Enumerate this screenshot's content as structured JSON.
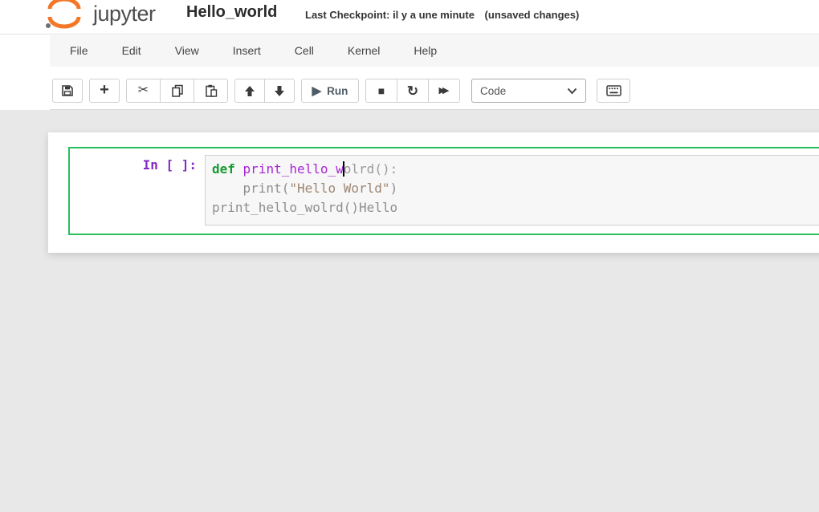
{
  "header": {
    "logo_text": "jupyter",
    "title": "Hello_world",
    "checkpoint": "Last Checkpoint: il y a une minute",
    "unsaved": "(unsaved changes)"
  },
  "menu": {
    "items": [
      {
        "label": "File"
      },
      {
        "label": "Edit"
      },
      {
        "label": "View"
      },
      {
        "label": "Insert"
      },
      {
        "label": "Cell"
      },
      {
        "label": "Kernel"
      },
      {
        "label": "Help"
      }
    ]
  },
  "toolbar": {
    "run_label": "Run",
    "cell_type_value": "Code",
    "glyphs": {
      "add": "+",
      "cut": "✂",
      "play": "▶",
      "stop": "■",
      "restart": "↻",
      "ff": "▶▶"
    }
  },
  "cell": {
    "prompt": "In [ ]:",
    "code": {
      "lines": [
        [
          [
            "kw",
            "def"
          ],
          [
            "plain",
            " "
          ],
          [
            "fname",
            "print_hello_w"
          ],
          [
            "cursor",
            ""
          ],
          [
            "dim",
            "olrd():"
          ]
        ],
        [
          [
            "muted",
            "    print("
          ],
          [
            "str",
            "\"Hello World\""
          ],
          [
            "muted",
            ")"
          ]
        ],
        [
          [
            "muted",
            "print_hello_wolrd()Hello"
          ]
        ]
      ]
    }
  },
  "colors": {
    "accent_green": "#28c05e",
    "logo_orange": "#f37726",
    "menu_bg": "#f6f6f6",
    "body_bg": "#e8e8e8"
  }
}
